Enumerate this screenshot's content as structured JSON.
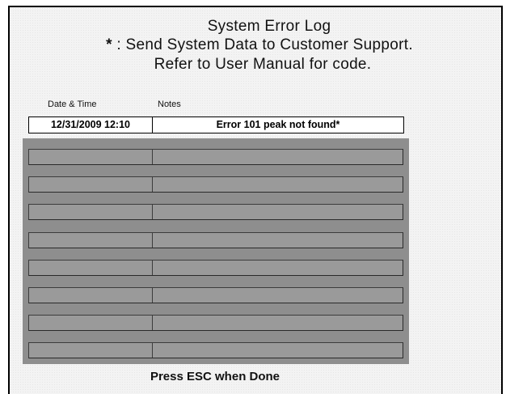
{
  "header": {
    "title": "System Error Log",
    "star": "*",
    "send_data": ": Send System Data to Customer Support.",
    "refer": "Refer to User Manual for code."
  },
  "columns": {
    "date_time": "Date & Time",
    "notes": "Notes"
  },
  "entries": [
    {
      "date_time": "12/31/2009 12:10",
      "notes": "Error 101 peak not found*"
    }
  ],
  "empty_row_count": 8,
  "footer": {
    "instruction": "Press ESC when Done"
  },
  "colors": {
    "panel_bg": "#8e8e8e",
    "empty_row_bg": "#9a9a9a",
    "window_bg": "#f3f3f3"
  }
}
